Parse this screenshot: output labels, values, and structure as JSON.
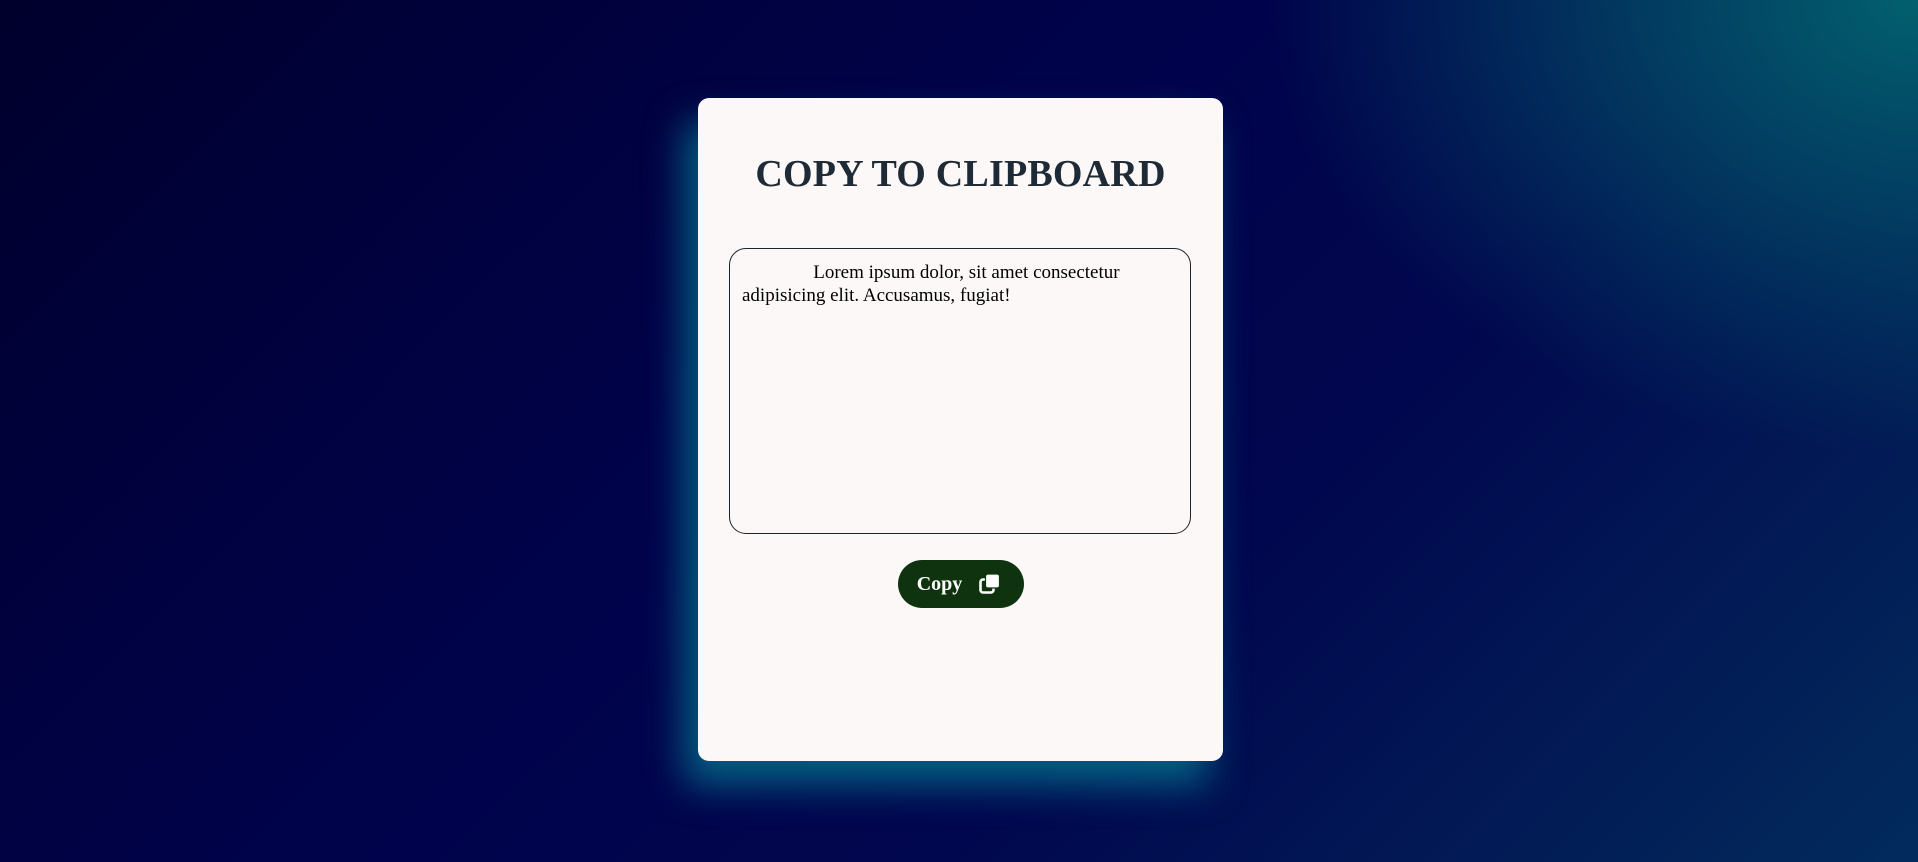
{
  "card": {
    "title": "COPY TO CLIPBOARD",
    "textarea_value": "               Lorem ipsum dolor, sit amet consectetur adipisicing elit. Accusamus, fugiat!",
    "copy_button": {
      "label": "Copy",
      "icon": "copy-icon"
    }
  },
  "colors": {
    "card_background": "#fcf8f8",
    "title_color": "#1e2a35",
    "button_background": "#10330f",
    "button_text": "#ffffff",
    "glow": "#057d96"
  }
}
